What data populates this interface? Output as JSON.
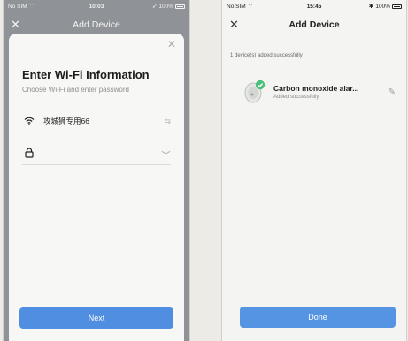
{
  "colors": {
    "primary_button": "#4f8ee0",
    "overlay": "#8f9296",
    "success_badge": "#4cc07a"
  },
  "left_screen": {
    "status": {
      "carrier": "No SIM",
      "time": "10:03",
      "battery": "100%"
    },
    "nav": {
      "title": "Add Device",
      "close_icon": "close-icon"
    },
    "sheet": {
      "title": "Enter Wi-Fi Information",
      "subtitle": "Choose Wi-Fi and enter password",
      "wifi_ssid": "攻城狮专用66",
      "password_value": "",
      "next_label": "Next"
    }
  },
  "right_screen": {
    "status": {
      "carrier": "No SIM",
      "time": "15:45",
      "battery": "100%"
    },
    "nav": {
      "title": "Add Device"
    },
    "added_count": "1 device(s) added successfully",
    "device": {
      "name": "Carbon monoxide alar...",
      "status": "Added successfully",
      "icon": "carbon-monoxide-detector-icon"
    },
    "done_label": "Done"
  }
}
